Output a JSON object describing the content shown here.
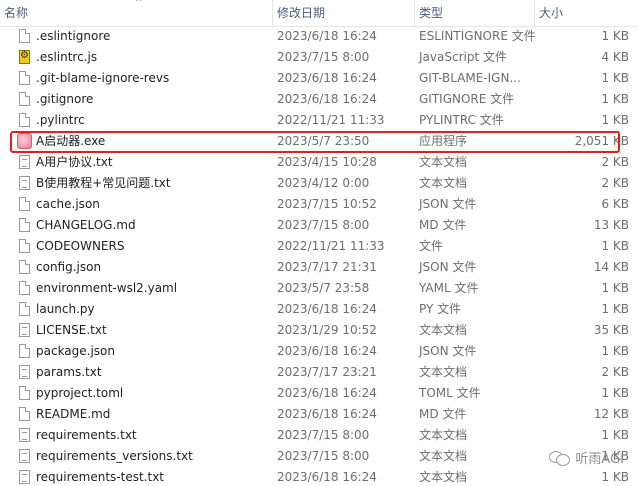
{
  "header": {
    "name": "名称",
    "date": "修改日期",
    "type": "类型",
    "size": "大小",
    "sort_arrow": "^"
  },
  "files": [
    {
      "name": ".eslintignore",
      "date": "2023/6/18 16:24",
      "type": "ESLINTIGNORE 文件",
      "size": "1 KB",
      "icon": "file-icon"
    },
    {
      "name": ".eslintrc.js",
      "date": "2023/7/15 8:00",
      "type": "JavaScript 文件",
      "size": "4 KB",
      "icon": "javascript-file-icon"
    },
    {
      "name": ".git-blame-ignore-revs",
      "date": "2023/6/18 16:24",
      "type": "GIT-BLAME-IGN...",
      "size": "1 KB",
      "icon": "file-icon"
    },
    {
      "name": ".gitignore",
      "date": "2023/6/18 16:24",
      "type": "GITIGNORE 文件",
      "size": "1 KB",
      "icon": "file-icon"
    },
    {
      "name": ".pylintrc",
      "date": "2022/11/21 11:33",
      "type": "PYLINTRC 文件",
      "size": "1 KB",
      "icon": "file-icon"
    },
    {
      "name": "A启动器.exe",
      "date": "2023/5/7 23:50",
      "type": "应用程序",
      "size": "2,051 KB",
      "icon": "application-icon",
      "highlighted": true
    },
    {
      "name": "A用户协议.txt",
      "date": "2023/4/15 10:28",
      "type": "文本文档",
      "size": "2 KB",
      "icon": "text-document-icon"
    },
    {
      "name": "B使用教程+常见问题.txt",
      "date": "2023/4/12 0:00",
      "type": "文本文档",
      "size": "2 KB",
      "icon": "text-document-icon"
    },
    {
      "name": "cache.json",
      "date": "2023/7/15 10:52",
      "type": "JSON 文件",
      "size": "6 KB",
      "icon": "file-icon"
    },
    {
      "name": "CHANGELOG.md",
      "date": "2023/7/15 8:00",
      "type": "MD 文件",
      "size": "13 KB",
      "icon": "file-icon"
    },
    {
      "name": "CODEOWNERS",
      "date": "2022/11/21 11:33",
      "type": "文件",
      "size": "1 KB",
      "icon": "file-icon"
    },
    {
      "name": "config.json",
      "date": "2023/7/17 21:31",
      "type": "JSON 文件",
      "size": "14 KB",
      "icon": "file-icon"
    },
    {
      "name": "environment-wsl2.yaml",
      "date": "2023/5/7 23:58",
      "type": "YAML 文件",
      "size": "1 KB",
      "icon": "file-icon"
    },
    {
      "name": "launch.py",
      "date": "2023/6/18 16:24",
      "type": "PY 文件",
      "size": "1 KB",
      "icon": "file-icon"
    },
    {
      "name": "LICENSE.txt",
      "date": "2023/1/29 10:52",
      "type": "文本文档",
      "size": "35 KB",
      "icon": "text-document-icon"
    },
    {
      "name": "package.json",
      "date": "2023/6/18 16:24",
      "type": "JSON 文件",
      "size": "1 KB",
      "icon": "file-icon"
    },
    {
      "name": "params.txt",
      "date": "2023/7/17 23:21",
      "type": "文本文档",
      "size": "2 KB",
      "icon": "text-document-icon"
    },
    {
      "name": "pyproject.toml",
      "date": "2023/6/18 16:24",
      "type": "TOML 文件",
      "size": "1 KB",
      "icon": "file-icon"
    },
    {
      "name": "README.md",
      "date": "2023/6/18 16:24",
      "type": "MD 文件",
      "size": "12 KB",
      "icon": "file-icon"
    },
    {
      "name": "requirements.txt",
      "date": "2023/7/15 8:00",
      "type": "文本文档",
      "size": "1 KB",
      "icon": "text-document-icon"
    },
    {
      "name": "requirements_versions.txt",
      "date": "2023/7/15 8:00",
      "type": "文本文档",
      "size": "1 KB",
      "icon": "text-document-icon"
    },
    {
      "name": "requirements-test.txt",
      "date": "2023/6/18 16:24",
      "type": "文本文档",
      "size": "1 KB",
      "icon": "text-document-icon"
    }
  ],
  "watermark": {
    "text": "听雨AGI",
    "icon": "wechat-icon"
  },
  "colors": {
    "highlight_border": "#e02020",
    "header_text": "#4c607a",
    "secondary_text": "#6d6d6d"
  }
}
